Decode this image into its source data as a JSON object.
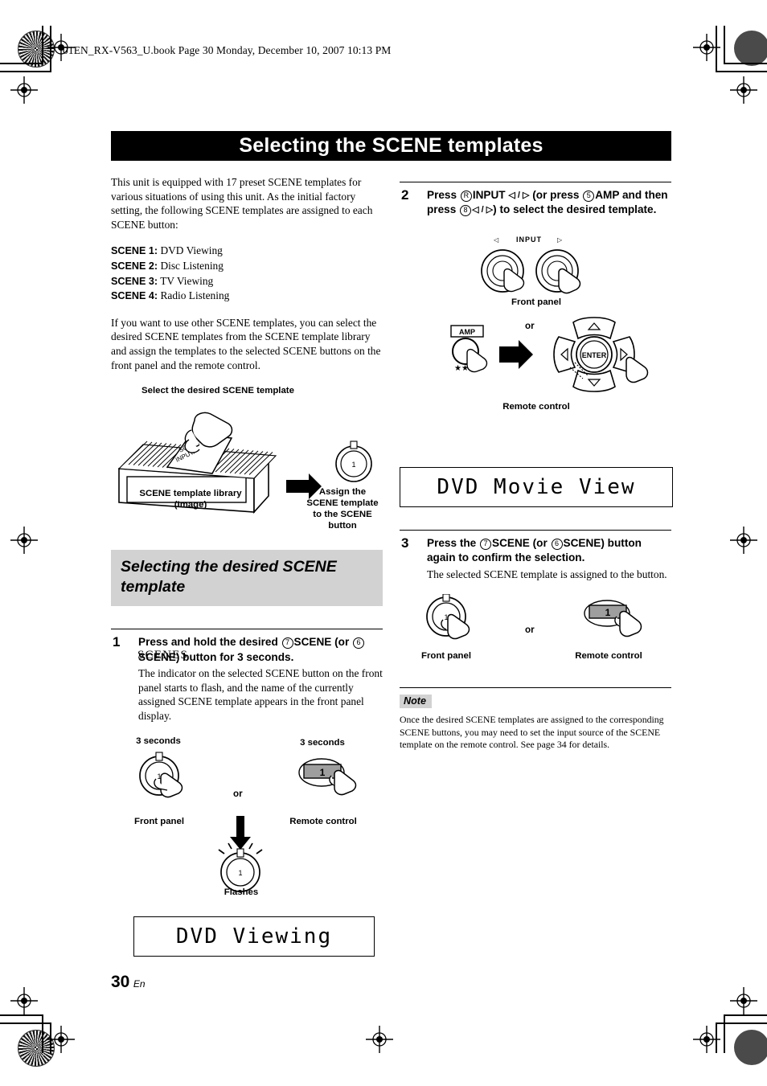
{
  "print": {
    "file_header": "01EN_RX-V563_U.book  Page 30  Monday, December 10, 2007  10:13 PM"
  },
  "title_bar": {
    "title": "Selecting the SCENE templates"
  },
  "left_column": {
    "intro_paragraph": "This unit is equipped with 17 preset SCENE templates for various situations of using this unit. As the initial factory setting, the following SCENE templates are assigned to each SCENE button:",
    "scene_assignments": [
      {
        "label": "SCENE 1:",
        "value": "DVD Viewing"
      },
      {
        "label": "SCENE 2:",
        "value": "Disc Listening"
      },
      {
        "label": "SCENE 3:",
        "value": "TV Viewing"
      },
      {
        "label": "SCENE 4:",
        "value": "Radio Listening"
      }
    ],
    "second_paragraph": "If you want to use other SCENE templates, you can select the desired SCENE templates from the SCENE template library and assign the templates to the selected SCENE buttons on the front panel and the remote control.",
    "library_figure": {
      "top_caption": "Select the desired SCENE template",
      "box_label": "SCENES",
      "card_label_line1": "SCENE",
      "card_label_line2": "INPUT:",
      "bottom_caption_line1": "SCENE template library",
      "bottom_caption_line2": "(Image)",
      "assign_caption": "Assign the SCENE template to the SCENE button",
      "button_number": "1"
    },
    "section_heading": "Selecting the desired SCENE template",
    "step1": {
      "number": "1",
      "lead_part1": "Press and hold the desired",
      "circle_a": "7",
      "bold_a": "SCENE",
      "lead_part2": "(or",
      "circle_b": "6",
      "bold_b": "SCENE",
      "lead_part3": ") button for 3 seconds.",
      "sub_text": "The indicator on the selected SCENE button on the front panel starts to flash, and the name of the currently assigned SCENE template appears in the front panel display.",
      "fig_hold_label": "3 seconds",
      "fig_front_panel": "Front panel",
      "fig_or": "or",
      "fig_remote": "Remote control",
      "fig_flashes": "Flashes",
      "button_number": "1"
    },
    "display_1": "DVD Viewing"
  },
  "right_column": {
    "step2": {
      "number": "2",
      "lead_part1": "Press",
      "circle_a": "R",
      "bold_a": "INPUT",
      "arrows_a": "◁ / ▷",
      "lead_part2": "(or press",
      "circle_b": "5",
      "bold_b": "AMP",
      "lead_part3": "and then press",
      "circle_c": "8",
      "arrows_b": "◁ / ▷",
      "lead_part4": ") to select the desired template.",
      "fig_input_label": "INPUT",
      "fig_left_arrow": "◁",
      "fig_right_arrow": "▷",
      "fig_front_panel": "Front panel",
      "fig_or": "or",
      "fig_amp_label": "AMP",
      "fig_enter_label": "ENTER",
      "fig_remote": "Remote control"
    },
    "display_2": "DVD Movie View",
    "step3": {
      "number": "3",
      "lead_part1": "Press the",
      "circle_a": "7",
      "bold_a": "SCENE",
      "lead_part2": "(or",
      "circle_b": "6",
      "bold_b": "SCENE",
      "lead_part3": ") button again to confirm the selection.",
      "sub_text": "The selected SCENE template is assigned to the button.",
      "fig_front_panel": "Front panel",
      "fig_or": "or",
      "fig_remote": "Remote control",
      "button_number": "1"
    },
    "note": {
      "tag": "Note",
      "text": "Once the desired SCENE templates are assigned to the corresponding SCENE buttons, you may need to set the input source of the SCENE template on the remote control. See page 34 for details."
    }
  },
  "footer": {
    "page_number": "30",
    "page_suffix": "En"
  },
  "colors": {
    "title_bar_bg": "#000000",
    "section_heading_bg": "#d2d2d2",
    "note_tag_bg": "#d2d2d2",
    "text": "#000000"
  }
}
